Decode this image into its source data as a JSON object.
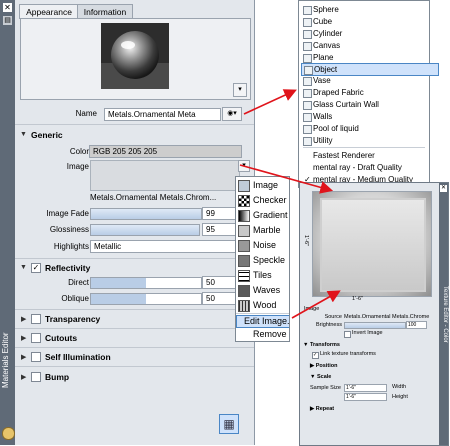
{
  "left_strip": {
    "title": "Materials Editor"
  },
  "tabs": [
    {
      "label": "Appearance"
    },
    {
      "label": "Information"
    }
  ],
  "name_row": {
    "label": "Name",
    "value": "Metals.Ornamental Meta"
  },
  "generic": {
    "title": "Generic",
    "color_label": "Color",
    "color_value": "RGB 205 205 205",
    "image_label": "Image",
    "image_name": "Metals.Ornamental Metals.Chrom...",
    "image_fade_label": "Image Fade",
    "image_fade_value": "99",
    "glossiness_label": "Glossiness",
    "glossiness_value": "95",
    "highlights_label": "Highlights",
    "highlights_value": "Metallic"
  },
  "reflectivity": {
    "title": "Reflectivity",
    "direct_label": "Direct",
    "direct_value": "50",
    "oblique_label": "Oblique",
    "oblique_value": "50"
  },
  "sections": [
    {
      "label": "Transparency"
    },
    {
      "label": "Cutouts"
    },
    {
      "label": "Self Illumination"
    },
    {
      "label": "Bump"
    }
  ],
  "object_menu": {
    "items": [
      {
        "label": "Sphere"
      },
      {
        "label": "Cube"
      },
      {
        "label": "Cylinder"
      },
      {
        "label": "Canvas"
      },
      {
        "label": "Plane"
      },
      {
        "label": "Object"
      },
      {
        "label": "Vase"
      },
      {
        "label": "Draped Fabric"
      },
      {
        "label": "Glass Curtain Wall"
      },
      {
        "label": "Walls"
      },
      {
        "label": "Pool of liquid"
      },
      {
        "label": "Utility"
      }
    ],
    "render_items": [
      {
        "label": "Fastest Renderer"
      },
      {
        "label": "mental ray - Draft Quality"
      },
      {
        "label": "mental ray - Medium Quality"
      }
    ],
    "selected": "Object"
  },
  "image_menu": {
    "items": [
      {
        "label": "Image"
      },
      {
        "label": "Checker"
      },
      {
        "label": "Gradient"
      },
      {
        "label": "Marble"
      },
      {
        "label": "Noise"
      },
      {
        "label": "Speckle"
      },
      {
        "label": "Tiles"
      },
      {
        "label": "Waves"
      },
      {
        "label": "Wood"
      }
    ],
    "edit_image": "Edit Image...",
    "remove_image": "Remove Imag"
  },
  "texture_editor": {
    "title": "Texture Editor - Color",
    "width_tick": "1'-6\"",
    "height_tick": "1'-6\"",
    "image_header": "Image",
    "source_label": "Source",
    "source_value": "Metals.Ornamental Metals.Chrome",
    "brightness_label": "Brightness",
    "brightness_value": "100",
    "invert_label": "Invert Image",
    "transforms_label": "Transforms",
    "link_label": "Link texture transforms",
    "position_label": "Position",
    "scale_label": "Scale",
    "sample_size_label": "Sample Size",
    "sample_w": "1'-6\"",
    "sample_h": "1'-6\"",
    "width_label": "Width",
    "height_label": "Height",
    "repeat_label": "Repeat"
  }
}
